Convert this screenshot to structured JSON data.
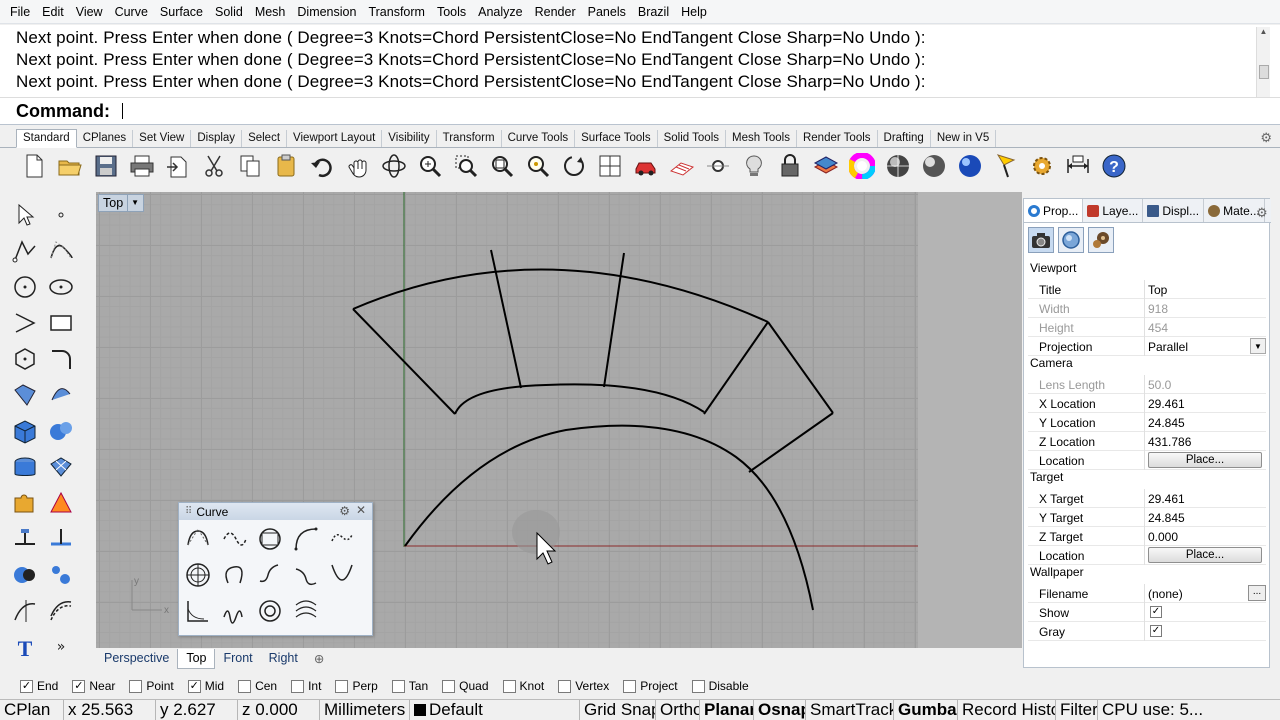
{
  "menu": [
    "File",
    "Edit",
    "View",
    "Curve",
    "Surface",
    "Solid",
    "Mesh",
    "Dimension",
    "Transform",
    "Tools",
    "Analyze",
    "Render",
    "Panels",
    "Brazil",
    "Help"
  ],
  "command": {
    "history": [
      "Next point. Press Enter when done ( Degree=3  Knots=Chord  PersistentClose=No  EndTangent  Close  Sharp=No  Undo ):",
      "Next point. Press Enter when done ( Degree=3  Knots=Chord  PersistentClose=No  EndTangent  Close  Sharp=No  Undo ):",
      "Next point. Press Enter when done ( Degree=3  Knots=Chord  PersistentClose=No  EndTangent  Close  Sharp=No  Undo ):"
    ],
    "prompt": "Command:",
    "value": ""
  },
  "toolbar_tabs": [
    "Standard",
    "CPlanes",
    "Set View",
    "Display",
    "Select",
    "Viewport Layout",
    "Visibility",
    "Transform",
    "Curve Tools",
    "Surface Tools",
    "Solid Tools",
    "Mesh Tools",
    "Render Tools",
    "Drafting",
    "New in V5"
  ],
  "toolbar_icons": [
    "new-icon",
    "open-icon",
    "save-icon",
    "print-icon",
    "import-icon",
    "cut-icon",
    "copy-icon",
    "paste-icon",
    "undo-icon",
    "pan-icon",
    "rotate-view-icon",
    "zoom-icon",
    "zoom-window-icon",
    "zoom-extents-icon",
    "zoom-selected-icon",
    "rotate-icon",
    "four-viewports-icon",
    "car-icon",
    "cplane-icon",
    "point-icon",
    "light-icon",
    "lock-icon",
    "layer-icon",
    "color-wheel-icon",
    "sphere-shaded-icon",
    "sphere-rendered-icon",
    "sphere-blue-icon",
    "flag-icon",
    "gear-options-icon",
    "dimension-icon",
    "help-icon"
  ],
  "viewport": {
    "title": "Top",
    "tabs": [
      "Perspective",
      "Top",
      "Front",
      "Right"
    ],
    "active_tab": "Top",
    "axis_y": "y",
    "axis_x": "x"
  },
  "curve_palette": {
    "title": "Curve"
  },
  "panel": {
    "tabs": [
      "Prop...",
      "Laye...",
      "Displ...",
      "Mate..."
    ],
    "viewport_section": "Viewport",
    "camera_section": "Camera",
    "target_section": "Target",
    "wallpaper_section": "Wallpaper",
    "viewport_rows": [
      {
        "label": "Title",
        "value": "Top"
      },
      {
        "label": "Width",
        "value": "918"
      },
      {
        "label": "Height",
        "value": "454"
      },
      {
        "label": "Projection",
        "value": "Parallel"
      }
    ],
    "camera_rows": [
      {
        "label": "Lens Length",
        "value": "50.0"
      },
      {
        "label": "X Location",
        "value": "29.461"
      },
      {
        "label": "Y Location",
        "value": "24.845"
      },
      {
        "label": "Z Location",
        "value": "431.786"
      },
      {
        "label": "Location",
        "value": "Place..."
      }
    ],
    "target_rows": [
      {
        "label": "X Target",
        "value": "29.461"
      },
      {
        "label": "Y Target",
        "value": "24.845"
      },
      {
        "label": "Z Target",
        "value": "0.000"
      },
      {
        "label": "Location",
        "value": "Place..."
      }
    ],
    "wallpaper_rows": [
      {
        "label": "Filename",
        "value": "(none)"
      },
      {
        "label": "Show",
        "value": "✓"
      },
      {
        "label": "Gray",
        "value": "✓"
      }
    ],
    "dots": "..."
  },
  "osnaps": [
    {
      "label": "End",
      "checked": true
    },
    {
      "label": "Near",
      "checked": true
    },
    {
      "label": "Point",
      "checked": false
    },
    {
      "label": "Mid",
      "checked": true
    },
    {
      "label": "Cen",
      "checked": false
    },
    {
      "label": "Int",
      "checked": false
    },
    {
      "label": "Perp",
      "checked": false
    },
    {
      "label": "Tan",
      "checked": false
    },
    {
      "label": "Quad",
      "checked": false
    },
    {
      "label": "Knot",
      "checked": false
    },
    {
      "label": "Vertex",
      "checked": false
    },
    {
      "label": "Project",
      "checked": false
    },
    {
      "label": "Disable",
      "checked": false
    }
  ],
  "status": {
    "cplane": "CPlan",
    "x": "x 25.563",
    "y": "y 2.627",
    "z": "z 0.000",
    "units": "Millimeters",
    "layer": "Default",
    "grid_snap": "Grid Snap",
    "ortho": "Ortho",
    "planar": "Planar",
    "osnap": "Osnap",
    "smarttrack": "SmartTrack",
    "gumball": "Gumball",
    "record_history": "Record History",
    "filter": "Filter",
    "cpu": "CPU use: 5..."
  },
  "colors": {
    "viewport_bg": "#a9a9a9",
    "curve": "#000000",
    "x_axis": "#8a2a2a",
    "y_axis": "#2a6a2a"
  }
}
